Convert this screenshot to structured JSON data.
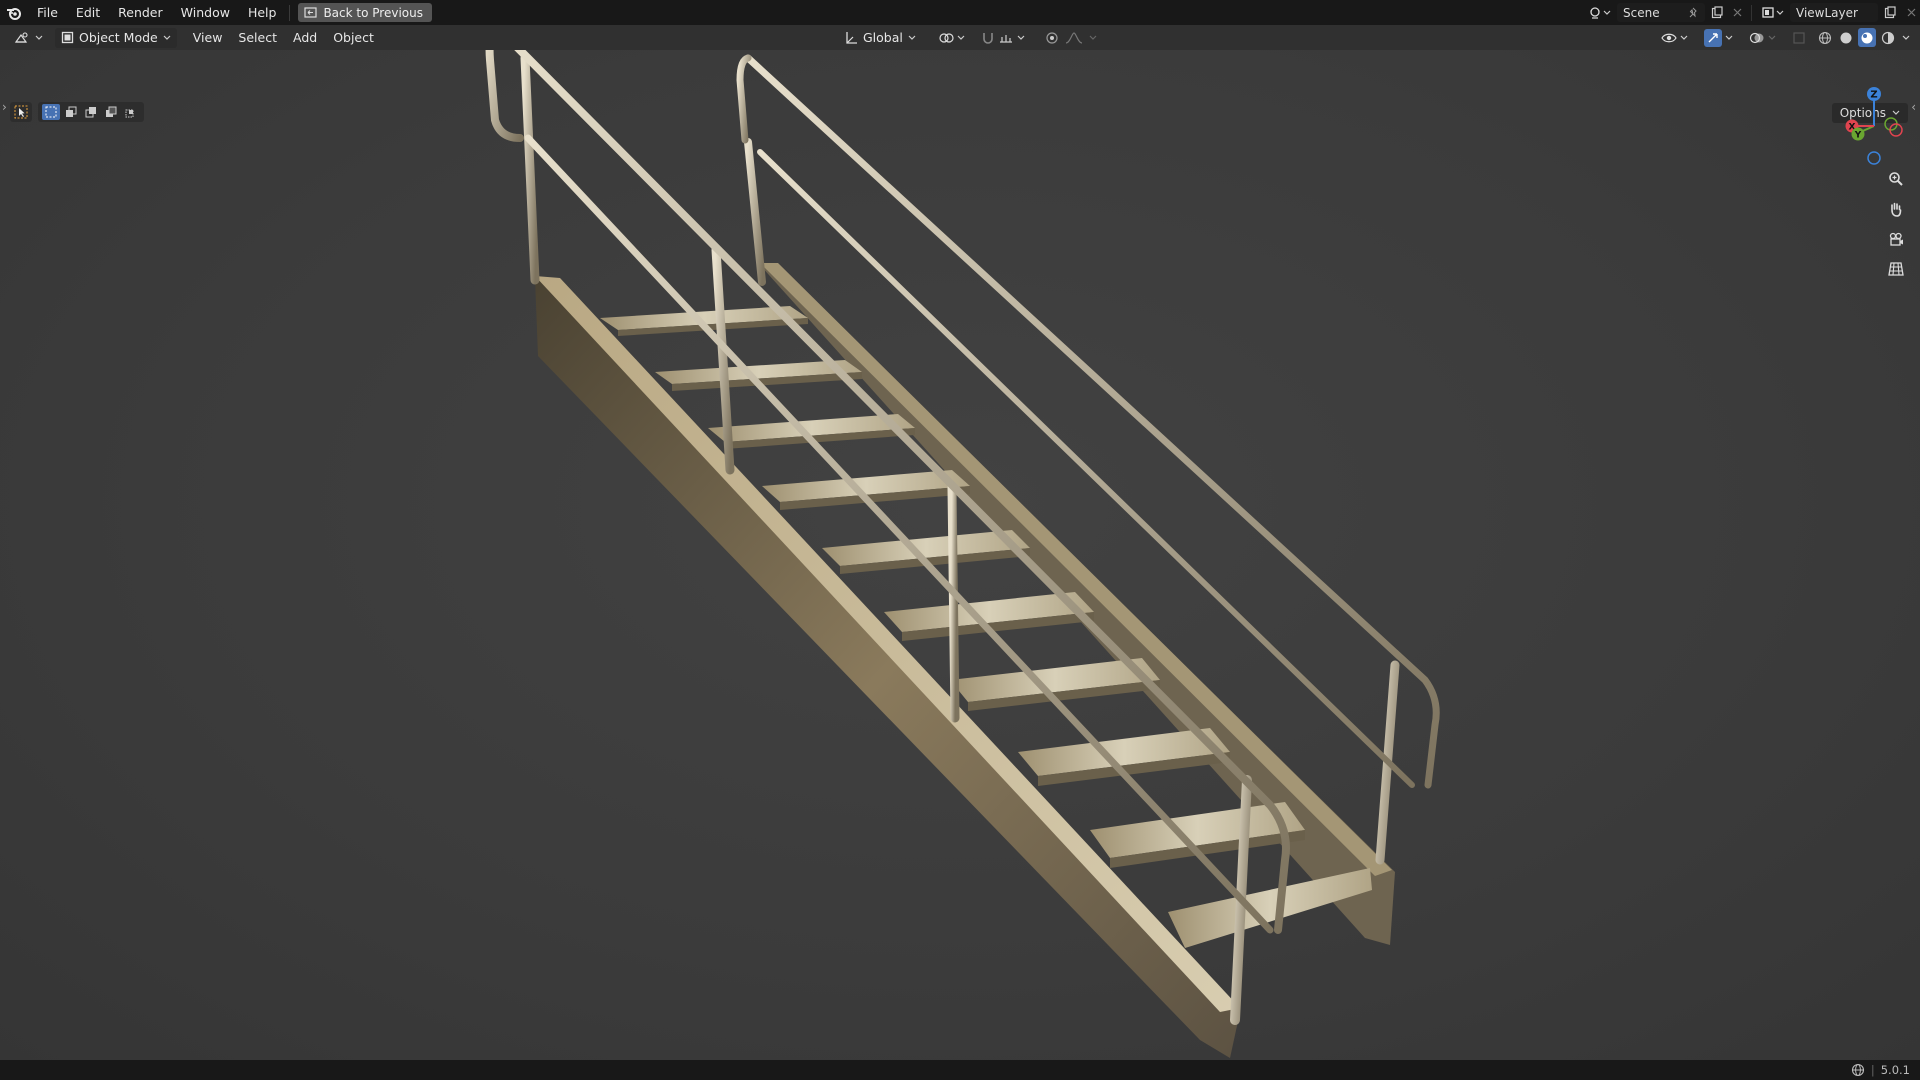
{
  "menu": {
    "items": [
      "File",
      "Edit",
      "Render",
      "Window",
      "Help"
    ],
    "back_label": "Back to Previous"
  },
  "scene": {
    "name": "Scene"
  },
  "view_layer": {
    "name": "ViewLayer"
  },
  "header": {
    "mode": "Object Mode",
    "menus": [
      "View",
      "Select",
      "Add",
      "Object"
    ],
    "transform_orientation": "Global",
    "options_label": "Options"
  },
  "gizmo": {
    "x_label": "X",
    "y_label": "Y",
    "z_label": "Z"
  },
  "status": {
    "version": "5.0.1"
  },
  "icons": {
    "blender": "blender-logo-icon",
    "editor_type": "3d-viewport-icon",
    "mode": "object-mode-icon",
    "orientation": "transform-orientation-icon",
    "pivot": "pivot-point-icon",
    "snap": "snap-icon",
    "proportional": "proportional-editing-icon",
    "zoom": "zoom-icon",
    "pan": "hand-icon",
    "camera": "camera-icon",
    "ortho": "grid-icon"
  },
  "colors": {
    "accent": "#4772b3",
    "axis_x": "#e0444f",
    "axis_y": "#6aa631",
    "axis_z": "#3b82d9",
    "topbar": "#181818",
    "header": "#303030",
    "viewport": "#3d3d3d"
  }
}
